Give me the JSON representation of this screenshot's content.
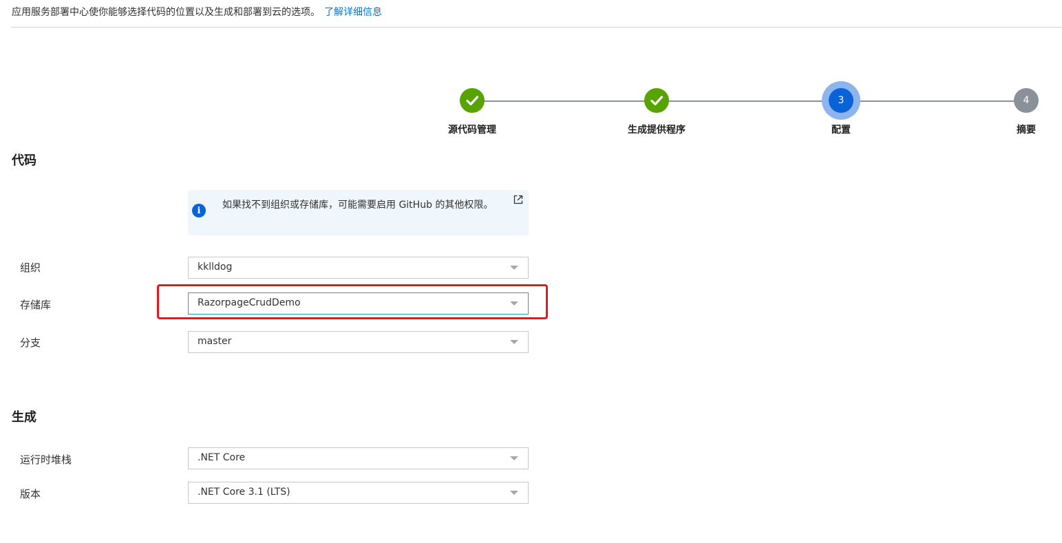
{
  "intro": {
    "text": "应用服务部署中心使你能够选择代码的位置以及生成和部署到云的选项。",
    "link": "了解详细信息"
  },
  "stepper": {
    "steps": [
      {
        "label": "源代码管理",
        "state": "done",
        "icon": "check-icon"
      },
      {
        "label": "生成提供程序",
        "state": "done",
        "icon": "check-icon"
      },
      {
        "label": "配置",
        "state": "active",
        "number": "3"
      },
      {
        "label": "摘要",
        "state": "pending",
        "number": "4"
      }
    ],
    "colors": {
      "done": "#57a300",
      "active": "#0a62d9",
      "pending": "#8a9198"
    }
  },
  "code_section": {
    "title": "代码",
    "info": {
      "text": "如果找不到组织或存储库，可能需要启用 GitHub 的其他权限。",
      "icon": "info-icon",
      "link_icon": "external-link-icon"
    },
    "fields": {
      "organization": {
        "label": "组织",
        "value": "kklldog"
      },
      "repository": {
        "label": "存储库",
        "value": "RazorpageCrudDemo"
      },
      "branch": {
        "label": "分支",
        "value": "master"
      }
    }
  },
  "build_section": {
    "title": "生成",
    "fields": {
      "runtime": {
        "label": "运行时堆栈",
        "value": ".NET Core"
      },
      "version": {
        "label": "版本",
        "value": ".NET Core 3.1 (LTS)"
      }
    }
  },
  "accent_colors": {
    "link": "#0078d4",
    "highlight": "#e8161d",
    "focus_border": "#2aa3a3"
  }
}
